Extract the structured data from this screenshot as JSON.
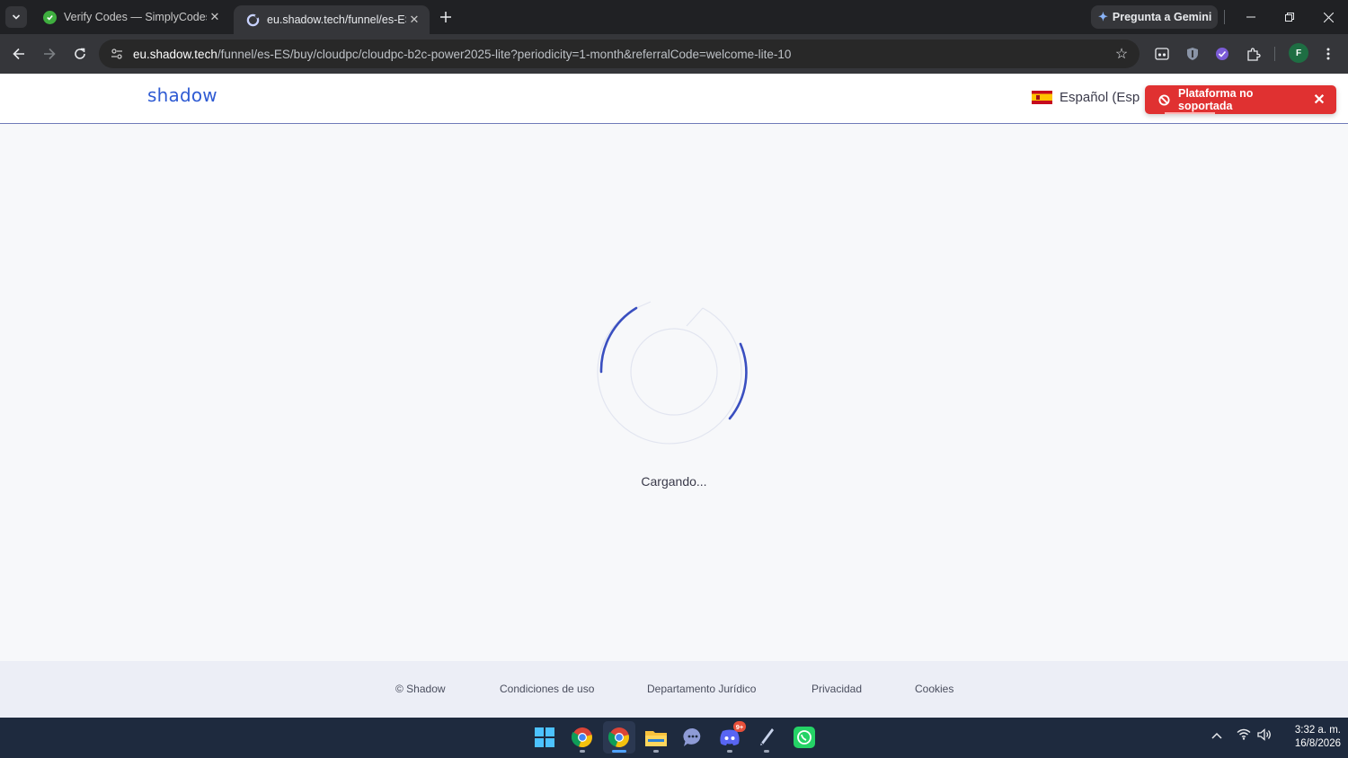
{
  "browser": {
    "tabs": [
      {
        "title": "Verify Codes — SimplyCodes",
        "active": false
      },
      {
        "title": "eu.shadow.tech/funnel/es-ES/b",
        "active": true
      }
    ],
    "gemini_label": "Pregunta a Gemini",
    "url_host": "eu.shadow.tech",
    "url_path": "/funnel/es-ES/buy/cloudpc/cloudpc-b2c-power2025-lite?periodicity=1-month&referralCode=welcome-lite-10",
    "profile_initial": "F"
  },
  "header": {
    "logo": "shadow",
    "language": "Español (Esp"
  },
  "toast": {
    "message": "Plataforma no soportada",
    "color": "#e03131"
  },
  "main": {
    "loading_text": "Cargando...",
    "spinner_color": "#3a4fc0"
  },
  "footer": {
    "links": [
      "© Shadow",
      "Condiciones de uso",
      "Departamento Jurídico",
      "Privacidad",
      "Cookies"
    ]
  },
  "taskbar": {
    "apps": [
      "start",
      "chrome",
      "chrome-active",
      "file-explorer",
      "chat",
      "discord",
      "pen-app",
      "whatsapp"
    ],
    "discord_badge": "9+",
    "time": "3:32 a. m.",
    "date": "16/8/2026"
  }
}
